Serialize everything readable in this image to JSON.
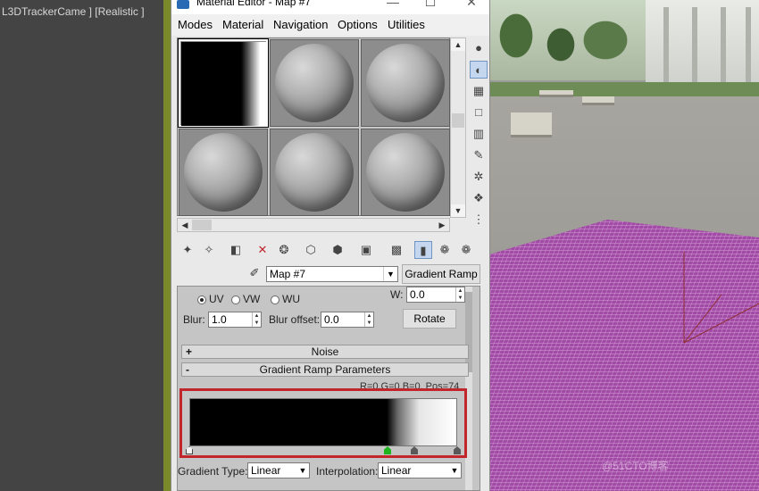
{
  "viewport_left": {
    "label": "L3DTrackerCame ] [Realistic ]"
  },
  "window": {
    "title": "Material Editor - Map #7",
    "controls": {
      "minimize": "—",
      "maximize": "☐",
      "close": "✕"
    },
    "menu": [
      "Modes",
      "Material",
      "Navigation",
      "Options",
      "Utilities"
    ]
  },
  "slots": {
    "count": 6,
    "active_index": 0,
    "types": [
      "gradient",
      "sphere",
      "sphere",
      "sphere",
      "sphere",
      "sphere"
    ]
  },
  "side_tools": [
    "sample-sphere-icon",
    "backlight-icon",
    "checker-background-icon",
    "sample-uv-tiling-icon",
    "video-color-check-icon",
    "make-preview-icon",
    "options-icon",
    "select-by-material-icon",
    "material-map-navigator-icon"
  ],
  "bottom_tools": [
    "get-material-icon",
    "put-to-scene-icon",
    "assign-to-selection-icon",
    "reset-map-icon",
    "make-unique-icon",
    "put-to-library-icon",
    "material-id-channel-icon",
    "show-shaded-material-icon",
    "show-end-result-icon",
    "go-to-parent-icon",
    "go-forward-icon"
  ],
  "map": {
    "name": "Map #7",
    "type_button": "Gradient Ramp"
  },
  "coords": {
    "radios": [
      {
        "label": "UV",
        "checked": true
      },
      {
        "label": "VW",
        "checked": false
      },
      {
        "label": "WU",
        "checked": false
      }
    ],
    "w_label": "W:",
    "w_value": "0.0",
    "blur_label": "Blur:",
    "blur_value": "1.0",
    "blur_offset_label": "Blur offset:",
    "blur_offset_value": "0.0",
    "rotate_button": "Rotate"
  },
  "rollouts": {
    "noise": {
      "sign": "+",
      "title": "Noise"
    },
    "gradient": {
      "sign": "-",
      "title": "Gradient Ramp Parameters"
    }
  },
  "ramp": {
    "info": "R=0,G=0,B=0, Pos=74",
    "flag_positions_percent": [
      0,
      74,
      84,
      100
    ],
    "gradient_type_label": "Gradient Type:",
    "gradient_type_value": "Linear",
    "interpolation_label": "Interpolation:",
    "interpolation_value": "Linear"
  },
  "watermark": "@51CTO博客"
}
